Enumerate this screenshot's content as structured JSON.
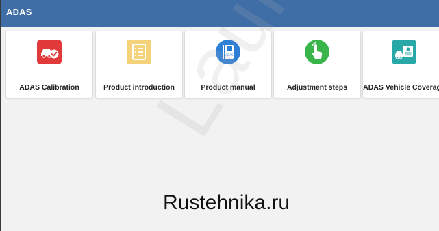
{
  "window": {
    "title": "ADAS",
    "header_color": "#3f6ea6"
  },
  "cards": [
    {
      "label": "ADAS Calibration",
      "icon": "car-check-icon",
      "color": "#e23a3a"
    },
    {
      "label": "Product introduction",
      "icon": "document-list-icon",
      "color": "#f3d27a"
    },
    {
      "label": "Product manual",
      "icon": "manual-book-icon",
      "color": "#2f7fd6"
    },
    {
      "label": "Adjustment steps",
      "icon": "tap-hand-icon",
      "color": "#39b54a"
    },
    {
      "label": "ADAS Vehicle Coverage",
      "icon": "vehicle-coverage-icon",
      "color": "#28a9a8"
    }
  ],
  "watermark": {
    "text": "Launch-E"
  },
  "footer_text": "Rustehnika.ru"
}
